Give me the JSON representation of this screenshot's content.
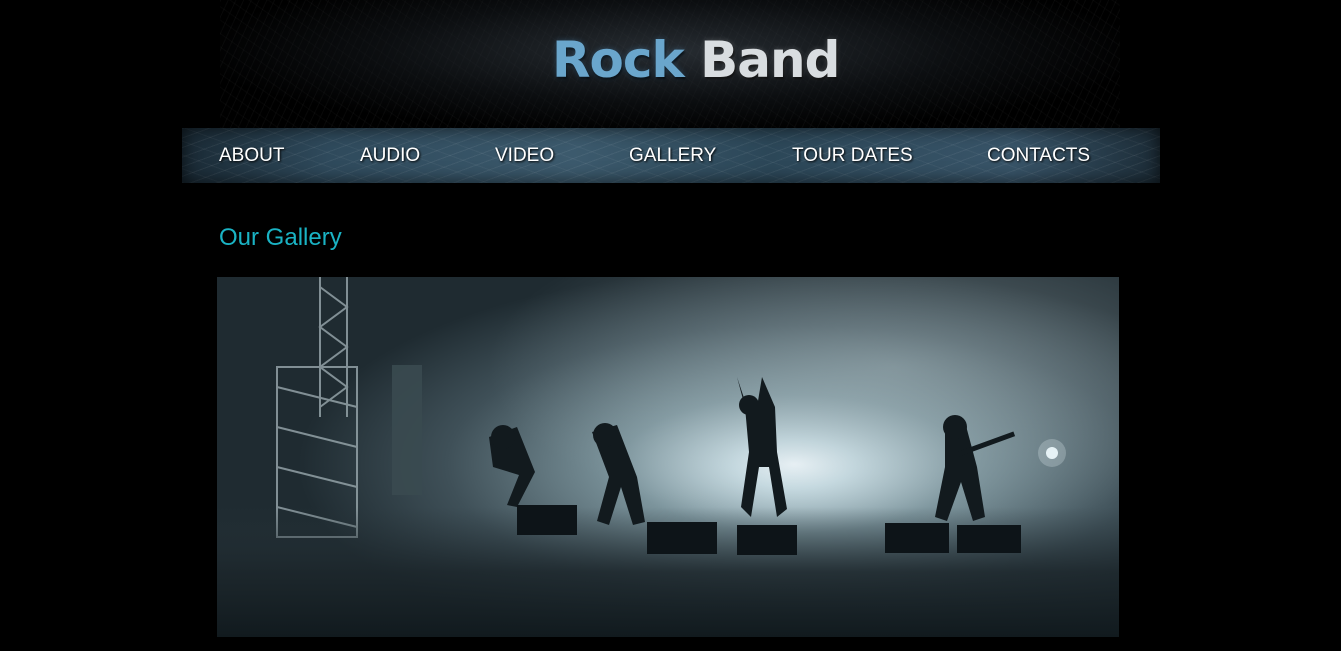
{
  "header": {
    "logo_part1": "Rock",
    "logo_part2": "Band"
  },
  "nav": {
    "items": [
      {
        "label": "ABOUT"
      },
      {
        "label": "AUDIO"
      },
      {
        "label": "VIDEO"
      },
      {
        "label": "GALLERY"
      },
      {
        "label": "TOUR DATES"
      },
      {
        "label": "CONTACTS"
      }
    ]
  },
  "main": {
    "title": "Our Gallery",
    "image": {
      "description_icon": "concert-photo"
    }
  },
  "colors": {
    "background": "#000000",
    "title": "#1ab3c4",
    "logo_rock": "#6aa6cc",
    "logo_band": "#d9dde0",
    "nav_text": "#ffffff"
  }
}
